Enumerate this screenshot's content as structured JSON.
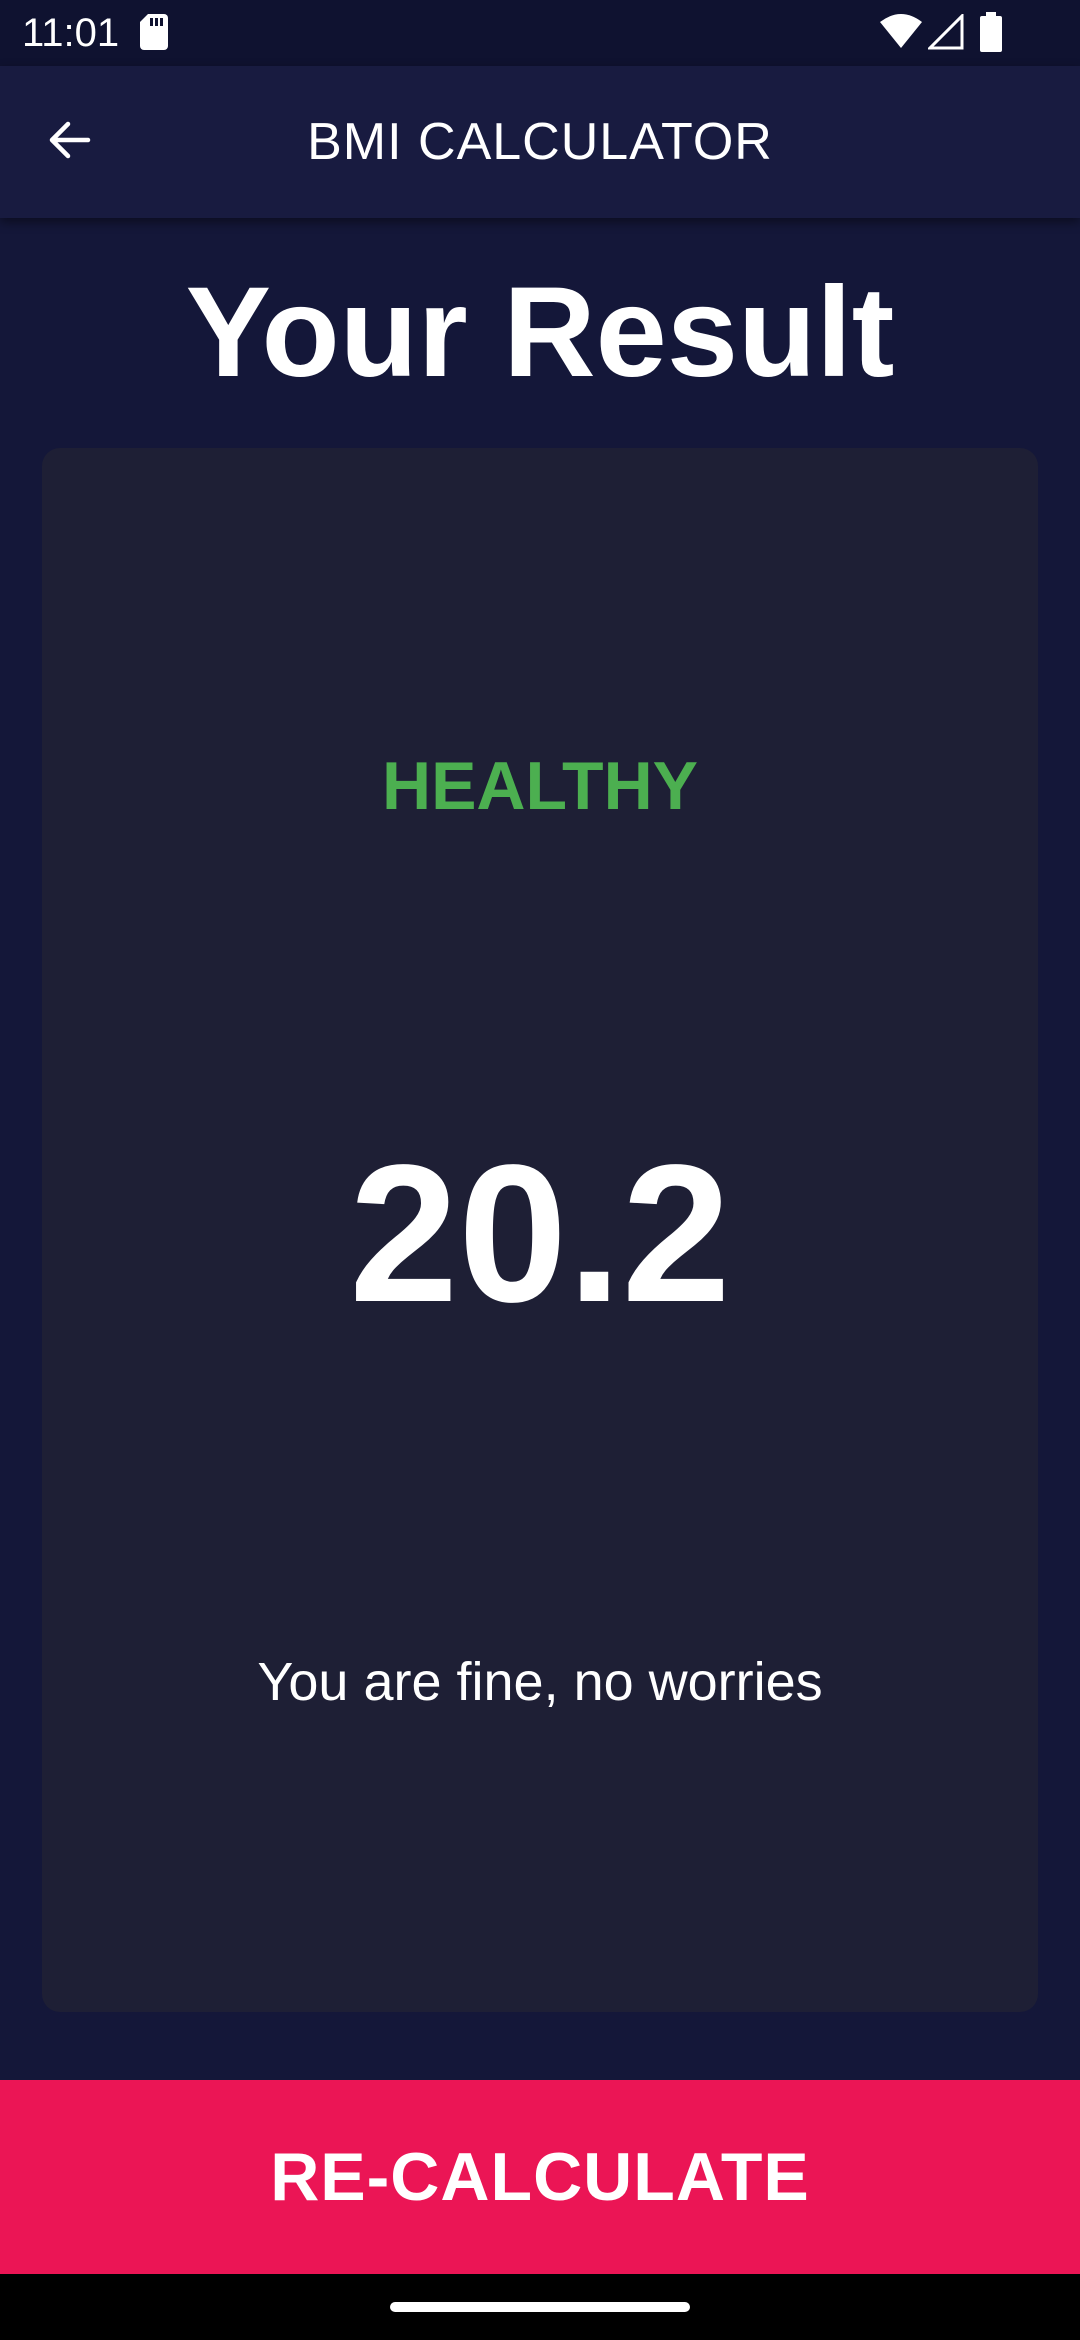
{
  "status_bar": {
    "time": "11:01",
    "icons": [
      "sd-card-icon",
      "wifi-icon",
      "cell-signal-icon",
      "battery-icon"
    ]
  },
  "app_bar": {
    "back_icon": "arrow-left-icon",
    "title": "BMI CALCULATOR"
  },
  "main": {
    "title": "Your Result",
    "result": {
      "status": "HEALTHY",
      "value": "20.2",
      "message": "You are fine, no worries"
    }
  },
  "button": {
    "label": "RE-CALCULATE"
  },
  "colors": {
    "background": "#141739",
    "app_bar": "#181b40",
    "card": "#1e1f35",
    "status_healthy": "#4caf50",
    "accent": "#eb1555"
  }
}
